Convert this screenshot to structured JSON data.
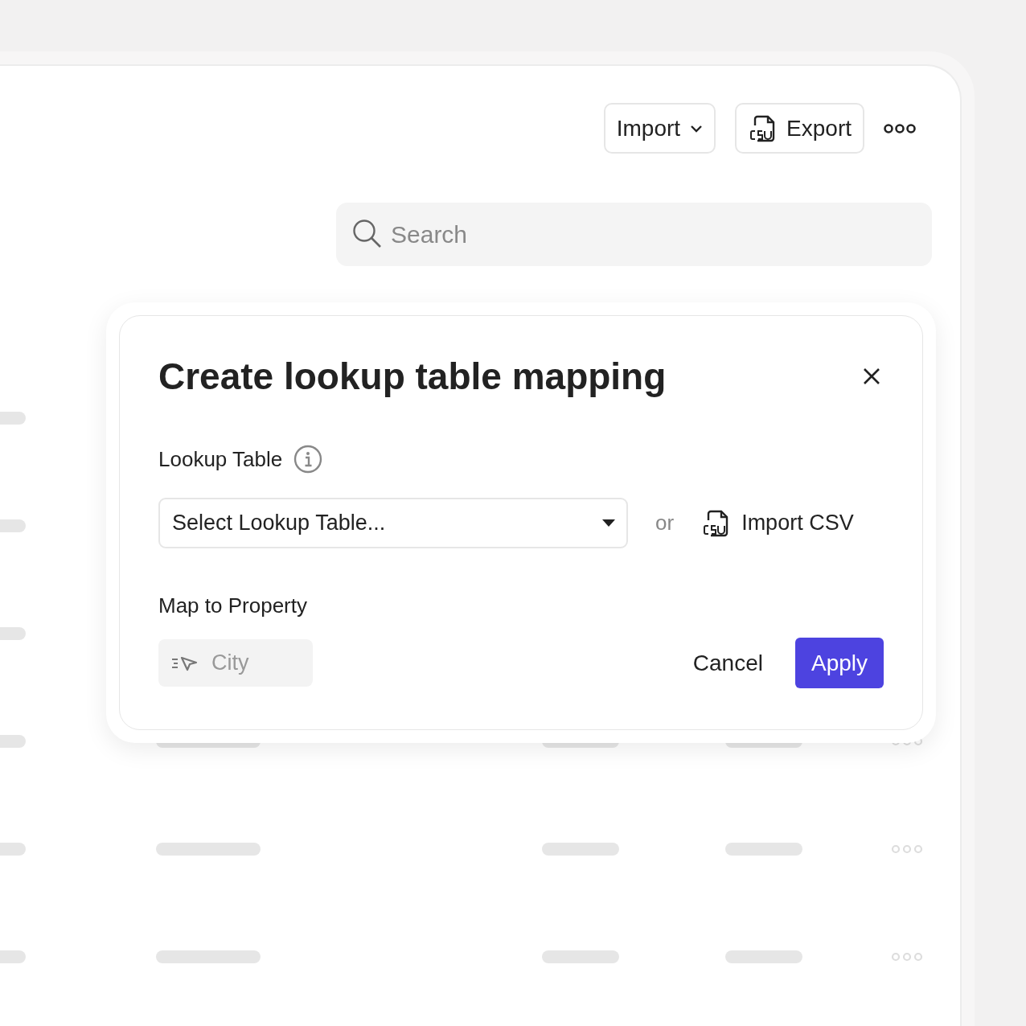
{
  "toolbar": {
    "import_button": {
      "label": "Import"
    },
    "export_button": {
      "label": "Export"
    }
  },
  "search": {
    "placeholder": "Search"
  },
  "dialog": {
    "title": "Create lookup table mapping",
    "lookup_table": {
      "label": "Lookup Table",
      "select_placeholder": "Select Lookup Table...",
      "separator": "or",
      "import_button": "Import CSV"
    },
    "map_to_property": {
      "label": "Map to Property",
      "value": "City",
      "disabled": true
    },
    "buttons": [
      {
        "kind": "secondary",
        "label": "Cancel"
      },
      {
        "kind": "primary",
        "label": "Apply"
      }
    ]
  }
}
